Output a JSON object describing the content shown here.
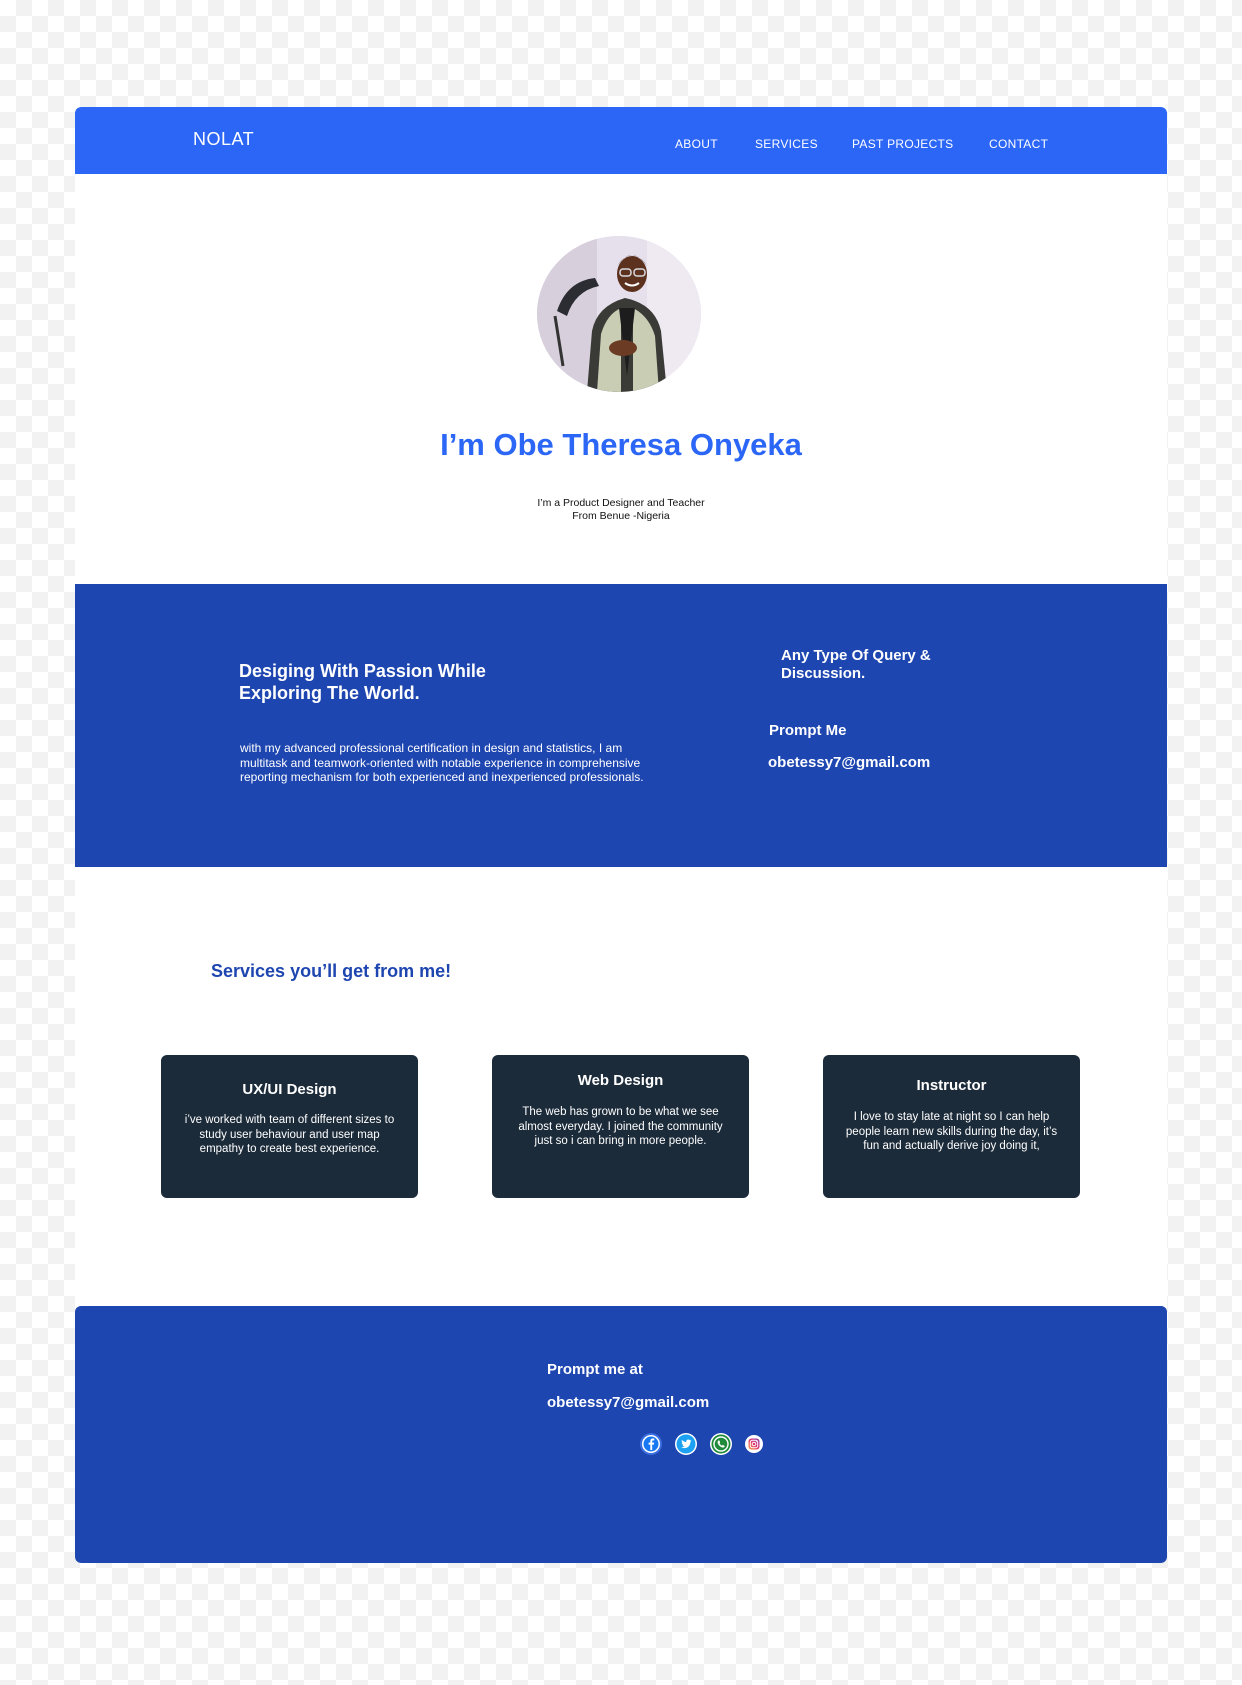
{
  "header": {
    "logo": "NOLAT",
    "nav": [
      "ABOUT",
      "SERVICES",
      "PAST PROJECTS",
      "CONTACT"
    ]
  },
  "hero": {
    "name": "I’m Obe Theresa Onyeka",
    "subtitle_line1": "I’m a Product Designer and Teacher",
    "subtitle_line2": "From Benue -Nigeria"
  },
  "passion": {
    "title": "Desiging With Passion While Exploring The World.",
    "text": "with my advanced professional certification in design and statistics, I am multitask and teamwork-oriented with notable experience in  comprehensive reporting mechanism for both experienced and inexperienced professionals.",
    "query_title": "Any Type Of Query & Discussion.",
    "prompt_label": "Prompt Me",
    "email": "obetessy7@gmail.com"
  },
  "services": {
    "title": "Services you’ll get from me!",
    "cards": [
      {
        "title": "UX/UI Design",
        "text": "i’ve worked with team of different sizes to study user behaviour and user map empathy to create best experience."
      },
      {
        "title": "Web Design",
        "text": "The web has grown to be what we see almost everyday. I joined the community just so i can bring in more people."
      },
      {
        "title": "Instructor",
        "text": "I love to stay late at night so I can help people learn new skills during the day, it’s fun and actually derive joy doing it,"
      }
    ]
  },
  "footer": {
    "label": "Prompt me at",
    "email": "obetessy7@gmail.com",
    "socials": [
      "facebook-icon",
      "twitter-icon",
      "whatsapp-icon",
      "instagram-icon"
    ]
  },
  "colors": {
    "nav_blue": "#2b66f6",
    "band_blue": "#1e46b0",
    "card_dark": "#1c2b3a"
  }
}
